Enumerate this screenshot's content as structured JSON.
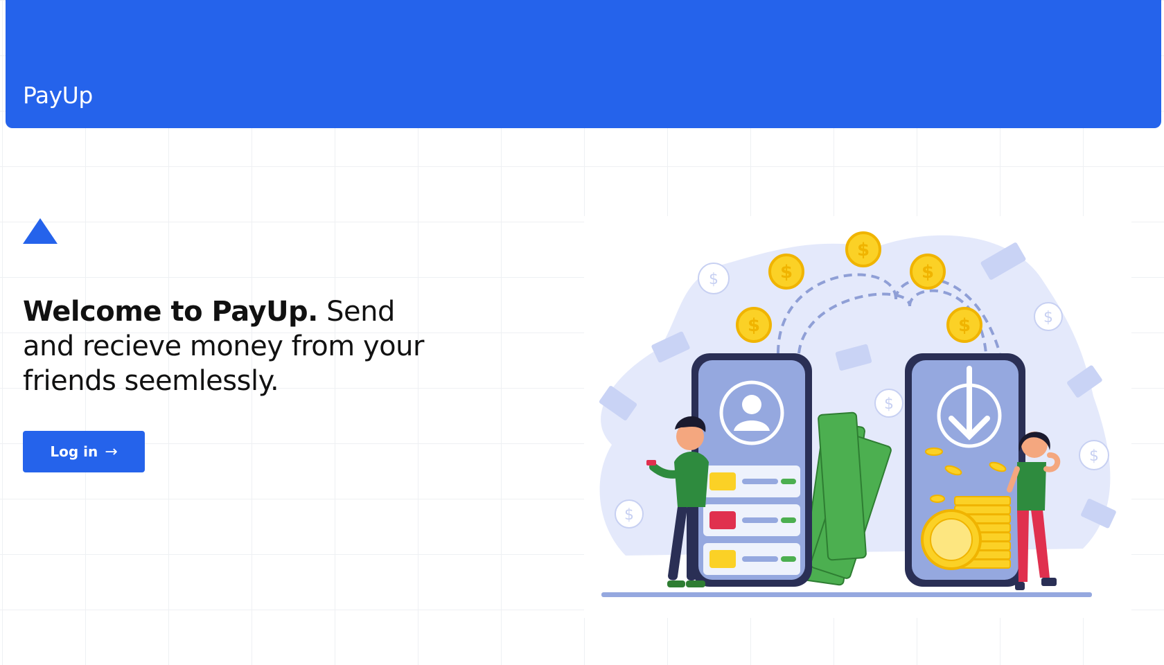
{
  "header": {
    "brand": "PayUp",
    "color": "#2563eb"
  },
  "hero": {
    "logo_icon": "triangle-logo",
    "headline_bold": "Welcome to PayUp.",
    "headline_rest": " Send and recieve money from your friends seemlessly.",
    "login_label": "Log in",
    "login_icon": "arrow-right-icon",
    "arrow_glyph": "→"
  },
  "illustration": {
    "subject": "two people exchanging money between two phones",
    "colors": {
      "blob": "#e4e9fb",
      "phone": "#95a8df",
      "phone_outline": "#2a2f55",
      "coin": "#fbd126",
      "cash": "#4caf50",
      "card_red": "#e0304e",
      "card_yellow": "#fbd126"
    }
  }
}
